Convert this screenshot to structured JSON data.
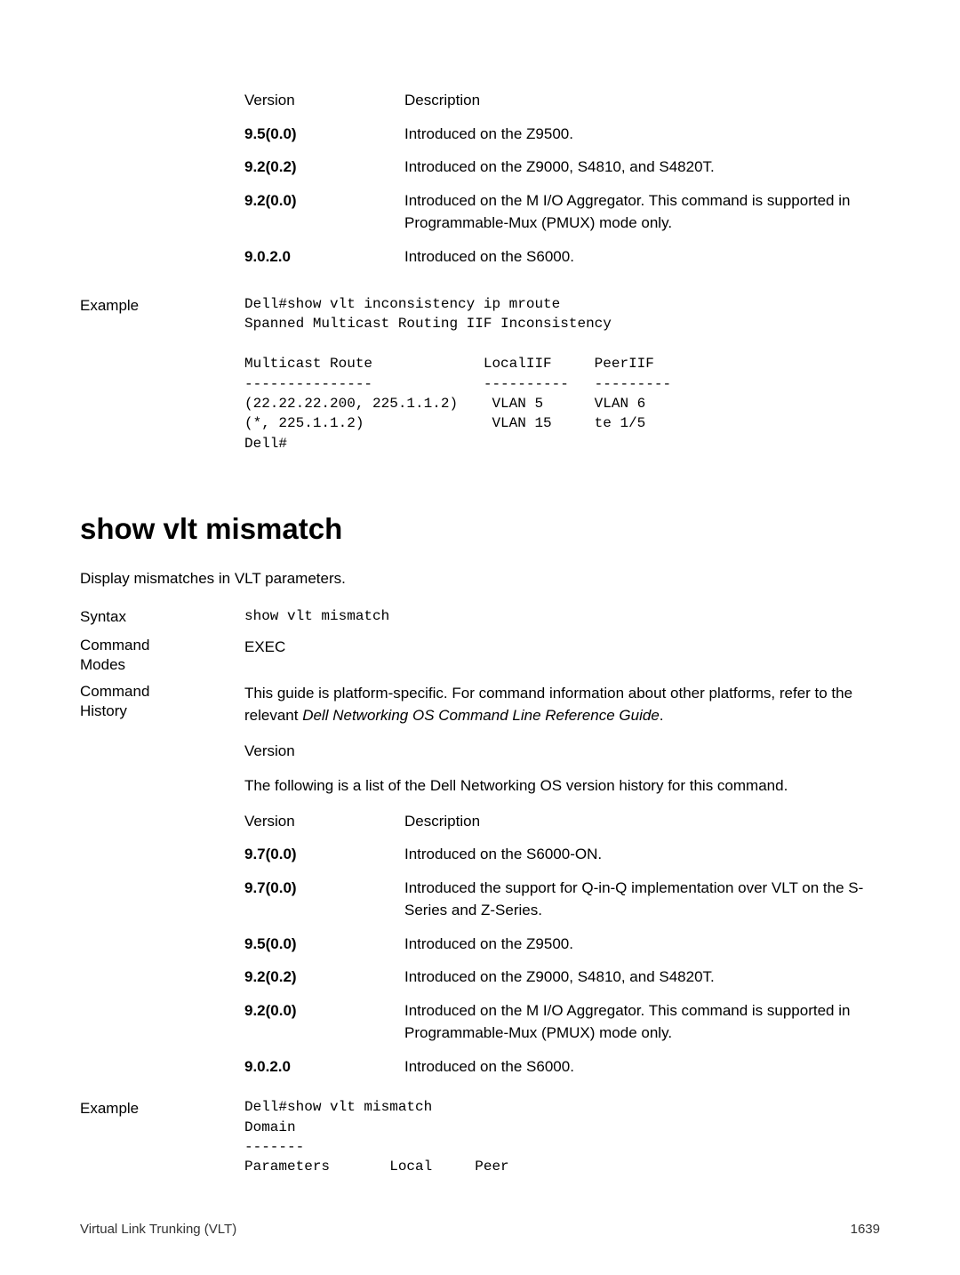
{
  "top_table": {
    "header": {
      "col1": "Version",
      "col2": "Description"
    },
    "rows": [
      {
        "ver": "9.5(0.0)",
        "desc": "Introduced on the Z9500."
      },
      {
        "ver": "9.2(0.2)",
        "desc": "Introduced on the Z9000, S4810, and S4820T."
      },
      {
        "ver": "9.2(0.0)",
        "desc": "Introduced on the M I/O Aggregator. This command is supported in Programmable-Mux (PMUX) mode only."
      },
      {
        "ver": "9.0.2.0",
        "desc": "Introduced on the S6000."
      }
    ]
  },
  "example1": {
    "label": "Example",
    "code": "Dell#show vlt inconsistency ip mroute\nSpanned Multicast Routing IIF Inconsistency\n\nMulticast Route             LocalIIF     PeerIIF\n---------------             ----------   ---------\n(22.22.22.200, 225.1.1.2)    VLAN 5      VLAN 6\n(*, 225.1.1.2)               VLAN 15     te 1/5\nDell#"
  },
  "section2": {
    "title": "show vlt mismatch",
    "desc": "Display mismatches in VLT parameters.",
    "syntax_label": "Syntax",
    "syntax_value": "show vlt mismatch",
    "modes_label1": "Command",
    "modes_label2": "Modes",
    "modes_value": "EXEC",
    "history_label1": "Command",
    "history_label2": "History",
    "history_text1": "This guide is platform-specific. For command information about other platforms, refer to the relevant ",
    "history_text1_italic": "Dell Networking OS Command Line Reference Guide",
    "history_version_label": "Version",
    "history_text2": "The following is a list of the Dell Networking OS version history for this command.",
    "table": {
      "header": {
        "col1": "Version",
        "col2": "Description"
      },
      "rows": [
        {
          "ver": "9.7(0.0)",
          "desc": "Introduced on the S6000-ON."
        },
        {
          "ver": "9.7(0.0)",
          "desc": "Introduced the support for Q-in-Q implementation over VLT on the S-Series and Z-Series."
        },
        {
          "ver": "9.5(0.0)",
          "desc": "Introduced on the Z9500."
        },
        {
          "ver": "9.2(0.2)",
          "desc": "Introduced on the Z9000, S4810, and S4820T."
        },
        {
          "ver": "9.2(0.0)",
          "desc": "Introduced on the M I/O Aggregator. This command is supported in Programmable-Mux (PMUX) mode only."
        },
        {
          "ver": "9.0.2.0",
          "desc": "Introduced on the S6000."
        }
      ]
    }
  },
  "example2": {
    "label": "Example",
    "code": "Dell#show vlt mismatch\nDomain\n-------\nParameters       Local     Peer"
  },
  "footer": {
    "left": "Virtual Link Trunking (VLT)",
    "right": "1639"
  }
}
